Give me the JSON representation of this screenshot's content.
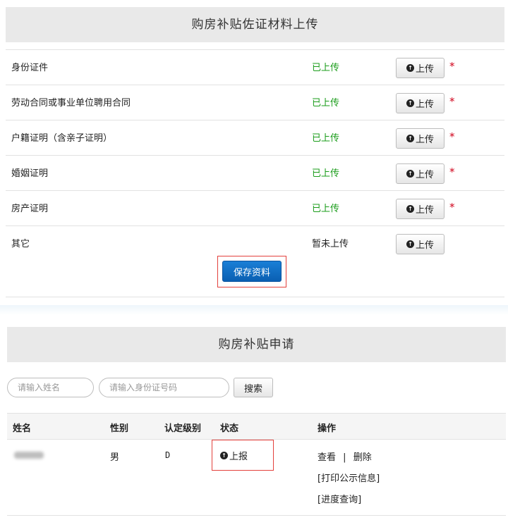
{
  "upload_section": {
    "title": "购房补贴佐证材料上传",
    "documents": [
      {
        "name": "身份证件",
        "status": "已上传",
        "status_type": "ok",
        "button": "上传",
        "required": true
      },
      {
        "name": "劳动合同或事业单位聘用合同",
        "status": "已上传",
        "status_type": "ok",
        "button": "上传",
        "required": true
      },
      {
        "name": "户籍证明（含亲子证明）",
        "status": "已上传",
        "status_type": "ok",
        "button": "上传",
        "required": true
      },
      {
        "name": "婚姻证明",
        "status": "已上传",
        "status_type": "ok",
        "button": "上传",
        "required": true
      },
      {
        "name": "房产证明",
        "status": "已上传",
        "status_type": "ok",
        "button": "上传",
        "required": true
      },
      {
        "name": "其它",
        "status": "暂未上传",
        "status_type": "pending",
        "button": "上传",
        "required": false
      }
    ],
    "required_mark": "*",
    "save_label": "保存资料"
  },
  "apply_section": {
    "title": "购房补贴申请",
    "search": {
      "name_placeholder": "请输入姓名",
      "id_placeholder": "请输入身份证号码",
      "button": "搜索"
    },
    "columns": [
      "姓名",
      "性别",
      "认定级别",
      "状态",
      "操作"
    ],
    "rows": [
      {
        "gender": "男",
        "level": "D",
        "status": "上报",
        "actions": {
          "view": "查看",
          "sep": "|",
          "delete": "删除",
          "print": "[打印公示信息]",
          "progress": "[进度查询]"
        }
      }
    ]
  },
  "icons": {
    "upload": "up-circle-icon",
    "report": "up-circle-icon"
  },
  "colors": {
    "success": "#1a9c1a",
    "required": "#d0021b",
    "primary": "#0a5fb2",
    "highlight": "#e3413c"
  }
}
